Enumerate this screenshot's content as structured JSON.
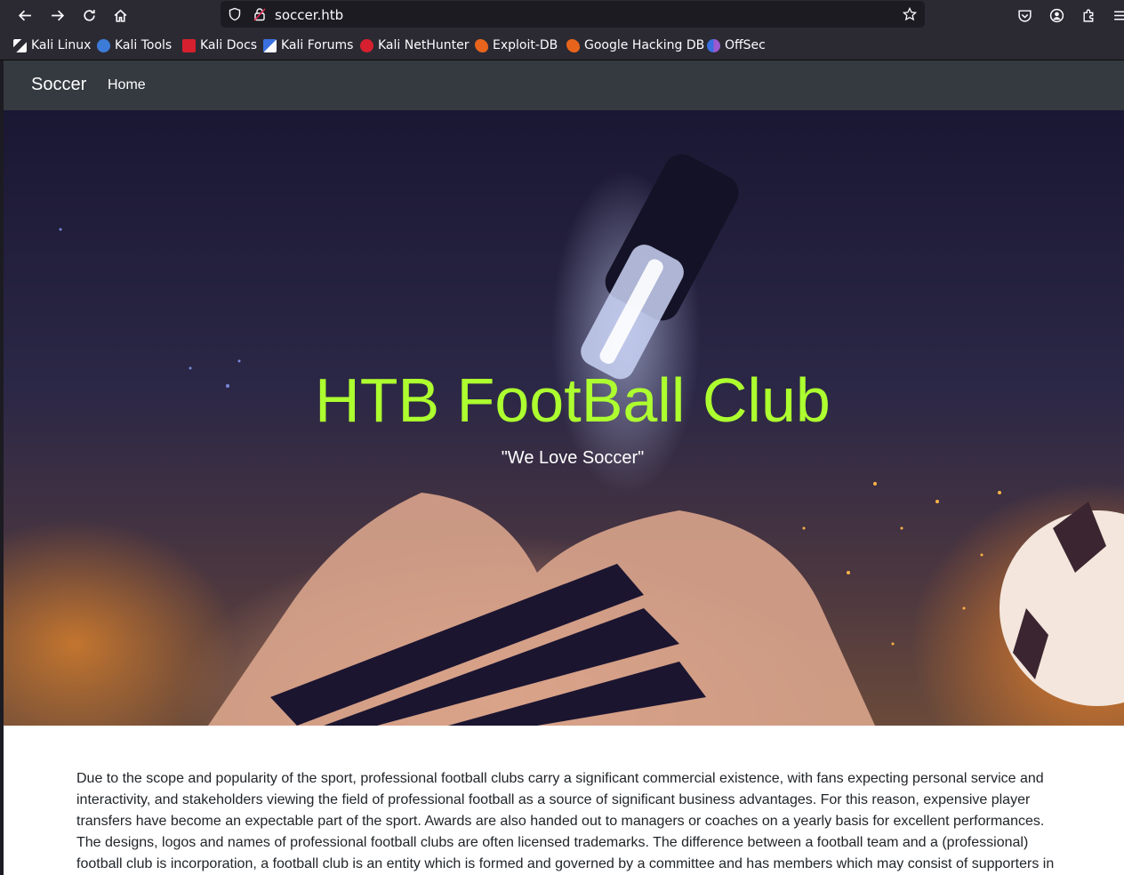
{
  "browser": {
    "url": "soccer.htb",
    "bookmarks": [
      {
        "label": "Kali Linux",
        "icon": "kali-dragon-icon"
      },
      {
        "label": "Kali Tools",
        "icon": "kali-tools-icon"
      },
      {
        "label": "Kali Docs",
        "icon": "kali-docs-icon"
      },
      {
        "label": "Kali Forums",
        "icon": "kali-forums-icon"
      },
      {
        "label": "Kali NetHunter",
        "icon": "kali-nethunter-icon"
      },
      {
        "label": "Exploit-DB",
        "icon": "exploit-db-icon"
      },
      {
        "label": "Google Hacking DB",
        "icon": "ghdb-icon"
      },
      {
        "label": "OffSec",
        "icon": "offsec-icon"
      }
    ]
  },
  "nav": {
    "brand": "Soccer",
    "home": "Home"
  },
  "hero": {
    "title": "HTB FootBall Club",
    "subtitle": "\"We Love Soccer\""
  },
  "content": {
    "paragraph": "Due to the scope and popularity of the sport, professional football clubs carry a significant commercial existence, with fans expecting personal service and interactivity, and stakeholders viewing the field of professional football as a source of significant business advantages. For this reason, expensive player transfers have become an expectable part of the sport. Awards are also handed out to managers or coaches on a yearly basis for excellent performances. The designs, logos and names of professional football clubs are often licensed trademarks. The difference between a football team and a (professional) football club is incorporation, a football club is an entity which is formed and governed by a committee and has members which may consist of supporters in"
  },
  "colors": {
    "hero_title": "#adff2f",
    "navbar": "#343a40",
    "chrome": "#2b2a33"
  }
}
